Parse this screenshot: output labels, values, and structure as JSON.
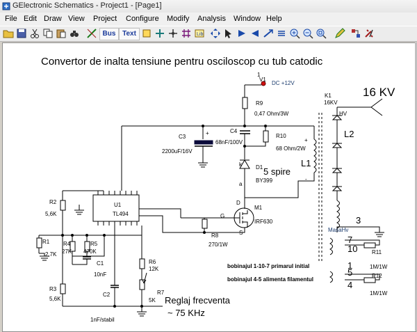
{
  "window": {
    "title": "GElectronic Schematics - Project1 - [Page1]"
  },
  "menu": {
    "items": [
      "File",
      "Edit",
      "Draw",
      "View",
      "Project",
      "Configure",
      "Modify",
      "Analysis",
      "Window",
      "Help"
    ]
  },
  "toolbar": {
    "text_button": "Text",
    "icons": [
      "open-folder-icon",
      "save-icon",
      "cut-icon",
      "copy-icon",
      "paste-icon",
      "find-icon",
      "wire-icon",
      "bus-icon",
      "part-icon",
      "label-icon",
      "junction-icon",
      "library-icon",
      "move-icon",
      "select-icon",
      "rotate-icon",
      "flip-icon",
      "zoom-in-icon",
      "zoom-out-icon",
      "zoom-fit-icon",
      "edit-icon",
      "netlist-icon",
      "tools-icon"
    ]
  },
  "schematic": {
    "title": "Convertor de inalta tensiune pentru osciloscop cu tub catodic",
    "hv_output": "16 KV",
    "v1": {
      "pin": "1",
      "name": "V1",
      "value": "DC +12V"
    },
    "r9": {
      "name": "R9",
      "value": "0,47 Ohm/3W"
    },
    "k1": {
      "name": "K1",
      "value": "16KV",
      "hv": "HV",
      "l2": "L2",
      "masa": "MasaHv"
    },
    "c4": {
      "name": "C4",
      "value": "68nF/100V"
    },
    "c3": {
      "name": "C3",
      "value": "2200uF/16V",
      "polarity": "+"
    },
    "r10": {
      "name": "R10",
      "value": "68 Ohm/2W"
    },
    "l1": {
      "name": "L1",
      "turns": "5 spire",
      "plus": "+",
      "minus": "-"
    },
    "d1": {
      "name": "D1",
      "value": "BY399",
      "k": "k",
      "a": "a"
    },
    "m1": {
      "name": "M1",
      "value": "IRF630",
      "d": "D",
      "g": "G",
      "s": "S"
    },
    "u1": {
      "name": "U1",
      "value": "TL494"
    },
    "r2": {
      "name": "R2",
      "value": "5,6K"
    },
    "r1": {
      "name": "R1",
      "value": "2,7K"
    },
    "r4": {
      "name": "R4",
      "value": "27K"
    },
    "r5": {
      "name": "R5",
      "value": "470K"
    },
    "c1": {
      "name": "C1",
      "value": "10nF"
    },
    "r3": {
      "name": "R3",
      "value": "5,6K"
    },
    "c2": {
      "name": "C2",
      "value": "1nF/stabil"
    },
    "r6": {
      "name": "R6",
      "value": "12K"
    },
    "r7": {
      "name": "R7",
      "value": "5K"
    },
    "r8": {
      "name": "R8",
      "value": "270/1W"
    },
    "r11": {
      "name": "R11",
      "value": "1M/1W"
    },
    "r12": {
      "name": "R12",
      "value": "1M/1W"
    },
    "pins": {
      "p3": "3",
      "p7": "7",
      "p10": "10",
      "p1": "1",
      "p5": "5",
      "p4": "4"
    },
    "notes": {
      "primary": "bobinajul 1-10-7 primarul initial",
      "filament": "bobinajul 4-5 alimenta filamentul",
      "freq_label": "Reglaj frecventa",
      "freq_value": "~ 75 KHz"
    }
  },
  "colors": {
    "wire": "#000000",
    "label_blue": "#1c3c6e",
    "supply_dot": "#d01010",
    "capacitor_fill": "#0a0a3a"
  }
}
